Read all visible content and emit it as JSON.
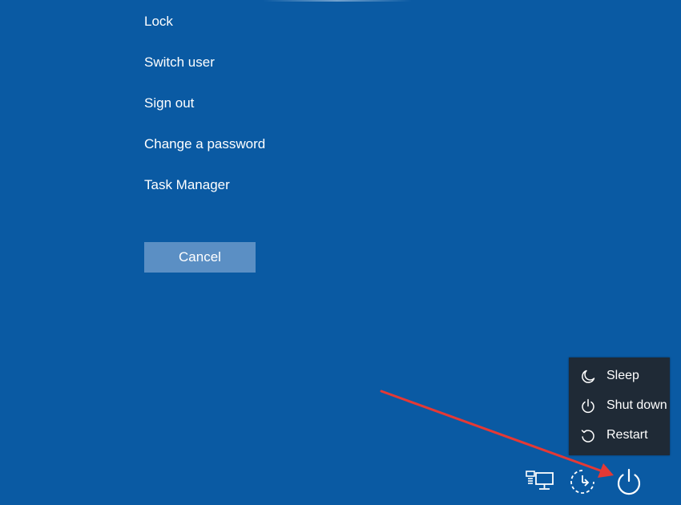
{
  "screen": {
    "background_color": "#0a5aa3"
  },
  "options_menu": {
    "items": [
      {
        "label": "Lock"
      },
      {
        "label": "Switch user"
      },
      {
        "label": "Sign out"
      },
      {
        "label": "Change a password"
      },
      {
        "label": "Task Manager"
      }
    ]
  },
  "cancel_button": {
    "label": "Cancel",
    "color": "#5b8fc4"
  },
  "power_menu": {
    "background_color": "#1f2a36",
    "items": [
      {
        "label": "Sleep",
        "icon": "moon-icon"
      },
      {
        "label": "Shut down",
        "icon": "power-icon"
      },
      {
        "label": "Restart",
        "icon": "restart-icon"
      }
    ]
  },
  "tray": {
    "icons": [
      "network-icon",
      "ease-of-access-icon",
      "power-icon"
    ]
  },
  "annotation": {
    "arrow_color": "#e53935"
  }
}
